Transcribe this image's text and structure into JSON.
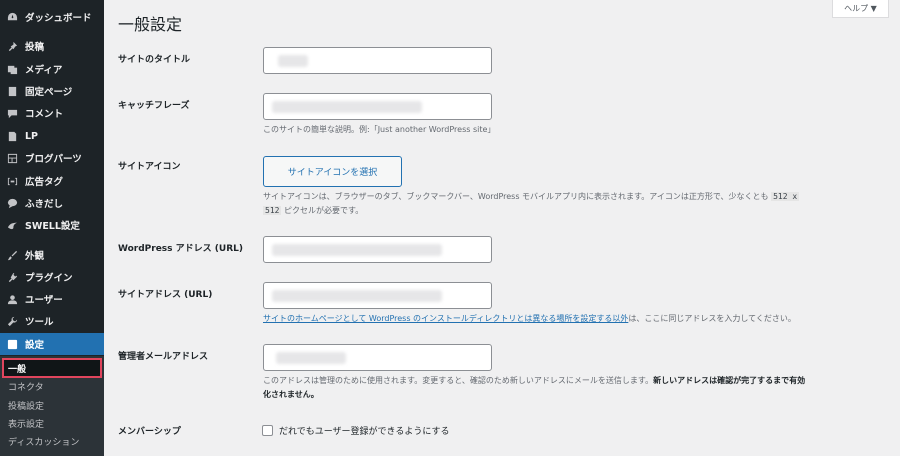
{
  "sidebar": {
    "items": [
      {
        "label": "ダッシュボード",
        "icon": "dashboard-icon"
      },
      {
        "label": "投稿",
        "icon": "pin-icon"
      },
      {
        "label": "メディア",
        "icon": "media-icon"
      },
      {
        "label": "固定ページ",
        "icon": "page-icon"
      },
      {
        "label": "コメント",
        "icon": "comment-icon"
      },
      {
        "label": "LP",
        "icon": "lp-page-icon"
      },
      {
        "label": "ブログパーツ",
        "icon": "blog-parts-icon"
      },
      {
        "label": "広告タグ",
        "icon": "ad-tag-icon"
      },
      {
        "label": "ふきだし",
        "icon": "balloon-icon"
      },
      {
        "label": "SWELL設定",
        "icon": "swell-icon"
      },
      {
        "label": "外観",
        "icon": "brush-icon"
      },
      {
        "label": "プラグイン",
        "icon": "plugin-icon"
      },
      {
        "label": "ユーザー",
        "icon": "user-icon"
      },
      {
        "label": "ツール",
        "icon": "wrench-icon"
      },
      {
        "label": "設定",
        "icon": "settings-icon"
      }
    ],
    "submenu": [
      "一般",
      "コネクタ",
      "投稿設定",
      "表示設定",
      "ディスカッション"
    ]
  },
  "header": {
    "help_label": "ヘルプ ▼",
    "title": "一般設定"
  },
  "form": {
    "site_title_label": "サイトのタイトル",
    "tagline_label": "キャッチフレーズ",
    "tagline_desc": "このサイトの簡単な説明。例:「Just another WordPress site」",
    "site_icon_label": "サイトアイコン",
    "site_icon_button": "サイトアイコンを選択",
    "site_icon_desc_1": "サイトアイコンは、ブラウザーのタブ、ブックマークバー、WordPress モバイルアプリ内に表示されます。アイコンは正方形で、少なくとも",
    "site_icon_desc_code1": "512 x",
    "site_icon_desc_code2": "512",
    "site_icon_desc_2": "ピクセルが必要です。",
    "wp_address_label": "WordPress アドレス (URL)",
    "site_address_label": "サイトアドレス (URL)",
    "site_address_link": "サイトのホームページとして WordPress のインストールディレクトリとは異なる場所を設定する以外",
    "site_address_desc": "は、ここに同じアドレスを入力してください。",
    "admin_email_label": "管理者メールアドレス",
    "admin_email_desc": "このアドレスは管理のために使用されます。変更すると、確認のため新しいアドレスにメールを送信します。",
    "admin_email_desc_bold_1": "新しいアドレスは確認が完了するまで有効",
    "admin_email_desc_bold_2": "化されません。",
    "membership_label": "メンバーシップ",
    "membership_checkbox": "だれでもユーザー登録ができるようにする"
  },
  "colors": {
    "sidebar_bg": "#1d2327",
    "active_blue": "#2271b1",
    "highlight_red": "#e0455d"
  }
}
